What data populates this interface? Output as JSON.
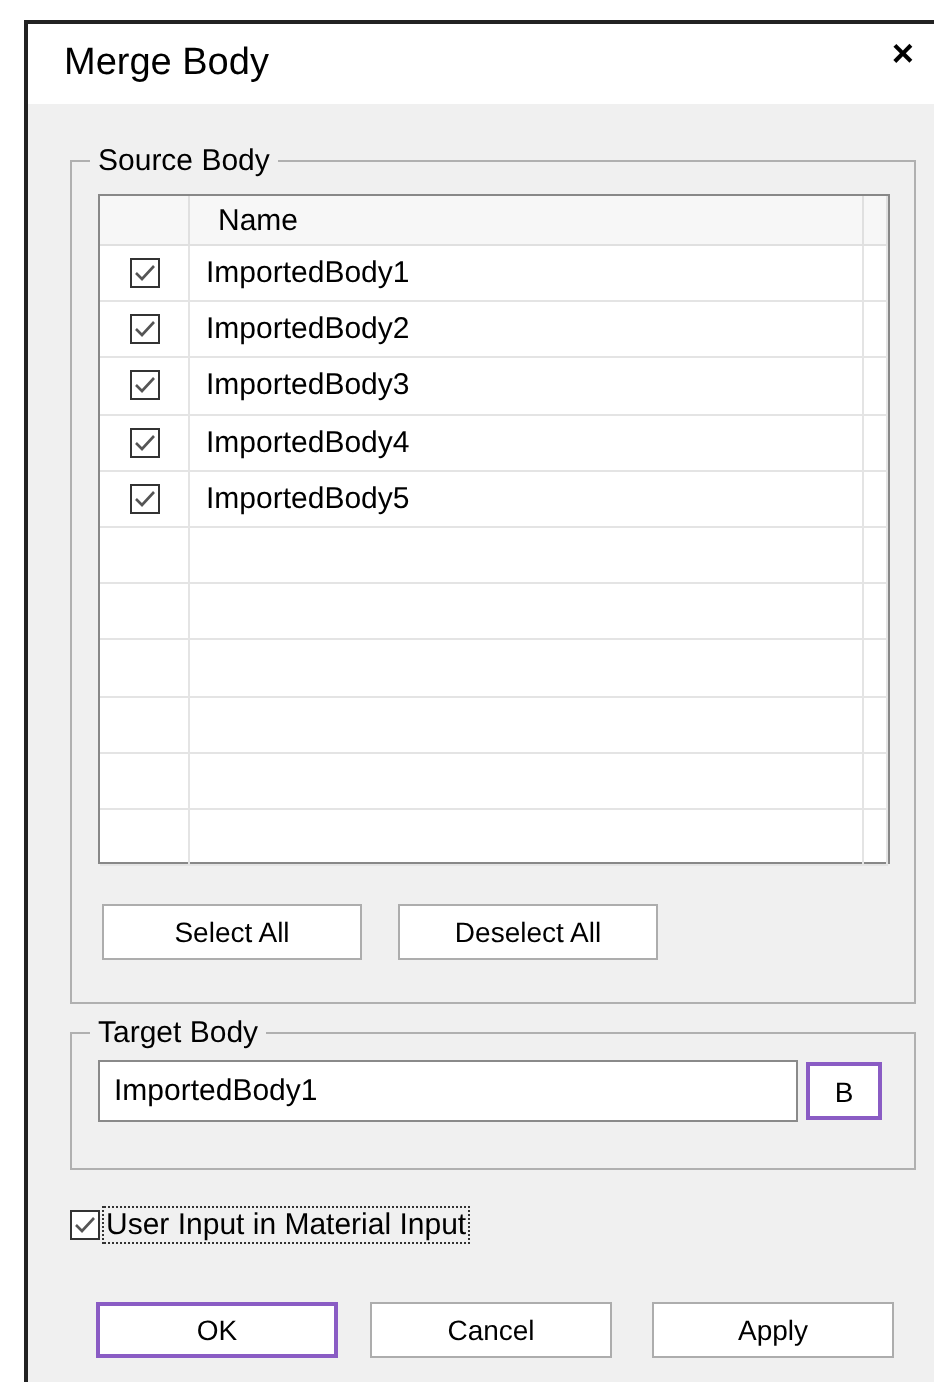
{
  "window": {
    "title": "Merge Body",
    "close": "×"
  },
  "source_body": {
    "title": "Source Body",
    "columns": [
      "Name"
    ],
    "rows": [
      {
        "name": "ImportedBody1",
        "checked": true
      },
      {
        "name": "ImportedBody2",
        "checked": true
      },
      {
        "name": "ImportedBody3",
        "checked": true
      },
      {
        "name": "ImportedBody4",
        "checked": true
      },
      {
        "name": "ImportedBody5",
        "checked": true
      }
    ],
    "buttons": [
      {
        "label": "Select All",
        "default": false
      },
      {
        "label": "Deselect All",
        "default": false
      }
    ]
  },
  "target_body": {
    "title": "Target Body",
    "value": "ImportedBody1",
    "button": {
      "label": "B",
      "default": true
    }
  },
  "option": {
    "label": "User Input in Material Input",
    "checked": true
  },
  "buttons": [
    {
      "label": "OK",
      "default": true
    },
    {
      "label": "Cancel",
      "default": false
    },
    {
      "label": "Apply",
      "default": false
    }
  ]
}
